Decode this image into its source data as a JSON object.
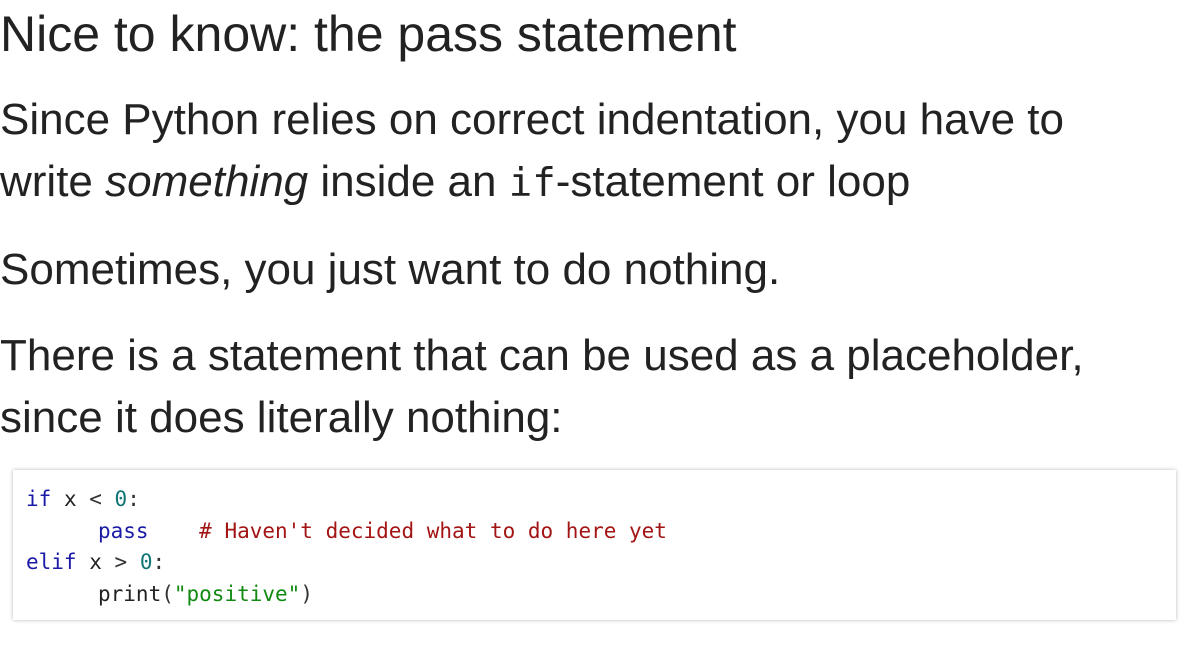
{
  "heading": "Nice to know: the pass statement",
  "paragraphs": {
    "p1_before": "Since Python relies on correct indentation, you have to",
    "p1_write": "write ",
    "p1_em": "something",
    "p1_mid": " inside an ",
    "p1_code": "if",
    "p1_after": "-statement or loop",
    "p2": "Sometimes, you just want to do nothing.",
    "p3_line1": "There is a statement that can be used as a placeholder,",
    "p3_line2": "since it does literally nothing:"
  },
  "code": {
    "line1": {
      "kw": "if",
      "sp1": " ",
      "var": "x",
      "op": " < ",
      "num": "0",
      "colon": ":"
    },
    "line2": {
      "kw": "pass",
      "gap": "    ",
      "comment": "# Haven't decided what to do here yet"
    },
    "line3": {
      "kw": "elif",
      "sp1": " ",
      "var": "x",
      "op": " > ",
      "num": "0",
      "colon": ":"
    },
    "line4": {
      "fn": "print",
      "open": "(",
      "str": "\"positive\"",
      "close": ")"
    }
  },
  "colors": {
    "keyword": "#1a1aa6",
    "number": "#127575",
    "comment": "#a31515",
    "string": "#128a12",
    "text": "#222222"
  }
}
